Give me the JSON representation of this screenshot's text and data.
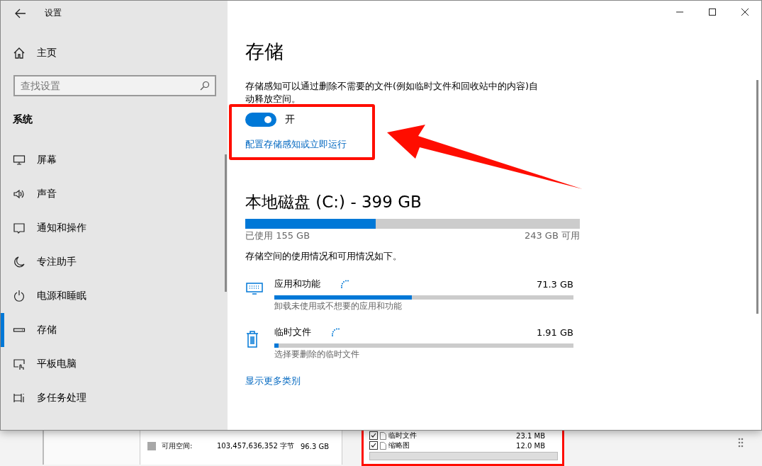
{
  "window": {
    "title": "设置"
  },
  "sidebar": {
    "home": "主页",
    "search": {
      "placeholder": "查找设置"
    },
    "section": "系统",
    "items": [
      {
        "kind": "display",
        "label": "屏幕",
        "selected": false
      },
      {
        "kind": "sound",
        "label": "声音",
        "selected": false
      },
      {
        "kind": "notify",
        "label": "通知和操作",
        "selected": false
      },
      {
        "kind": "moon",
        "label": "专注助手",
        "selected": false
      },
      {
        "kind": "power",
        "label": "电源和睡眠",
        "selected": false
      },
      {
        "kind": "storage",
        "label": "存储",
        "selected": true
      },
      {
        "kind": "tablet",
        "label": "平板电脑",
        "selected": false
      },
      {
        "kind": "multitask",
        "label": "多任务处理",
        "selected": false
      }
    ]
  },
  "main": {
    "title": "存储",
    "description": "存储感知可以通过删除不需要的文件(例如临时文件和回收站中的内容)自动释放空间。",
    "toggle": {
      "on": true,
      "label": "开"
    },
    "link": "配置存储感知或立即运行",
    "disk": {
      "title": "本地磁盘 (C:) - 399 GB",
      "level": 0.39,
      "used": "已使用 155 GB",
      "free": "243 GB 可用"
    },
    "summary": "存储空间的使用情况和可用情况如下。",
    "categories": [
      {
        "kind": "apps",
        "name": "应用和功能",
        "size": "71.3 GB",
        "level": 0.46,
        "hint": "卸载未使用或不想要的应用和功能"
      },
      {
        "kind": "temp",
        "name": "临时文件",
        "size": "1.91 GB",
        "level": 0.015,
        "hint": "选择要删除的临时文件"
      }
    ],
    "more_link": "显示更多类别"
  },
  "background_window": {
    "legend": [
      {
        "label": "可用空间:",
        "bytes": "103,457,636,352 字节",
        "size": "96.3 GB",
        "color": "#a8a8a8"
      }
    ],
    "files": [
      {
        "name": "临时文件",
        "size": "23.1 MB",
        "checked": true
      },
      {
        "name": "缩略图",
        "size": "12.0 MB",
        "checked": true
      }
    ]
  }
}
